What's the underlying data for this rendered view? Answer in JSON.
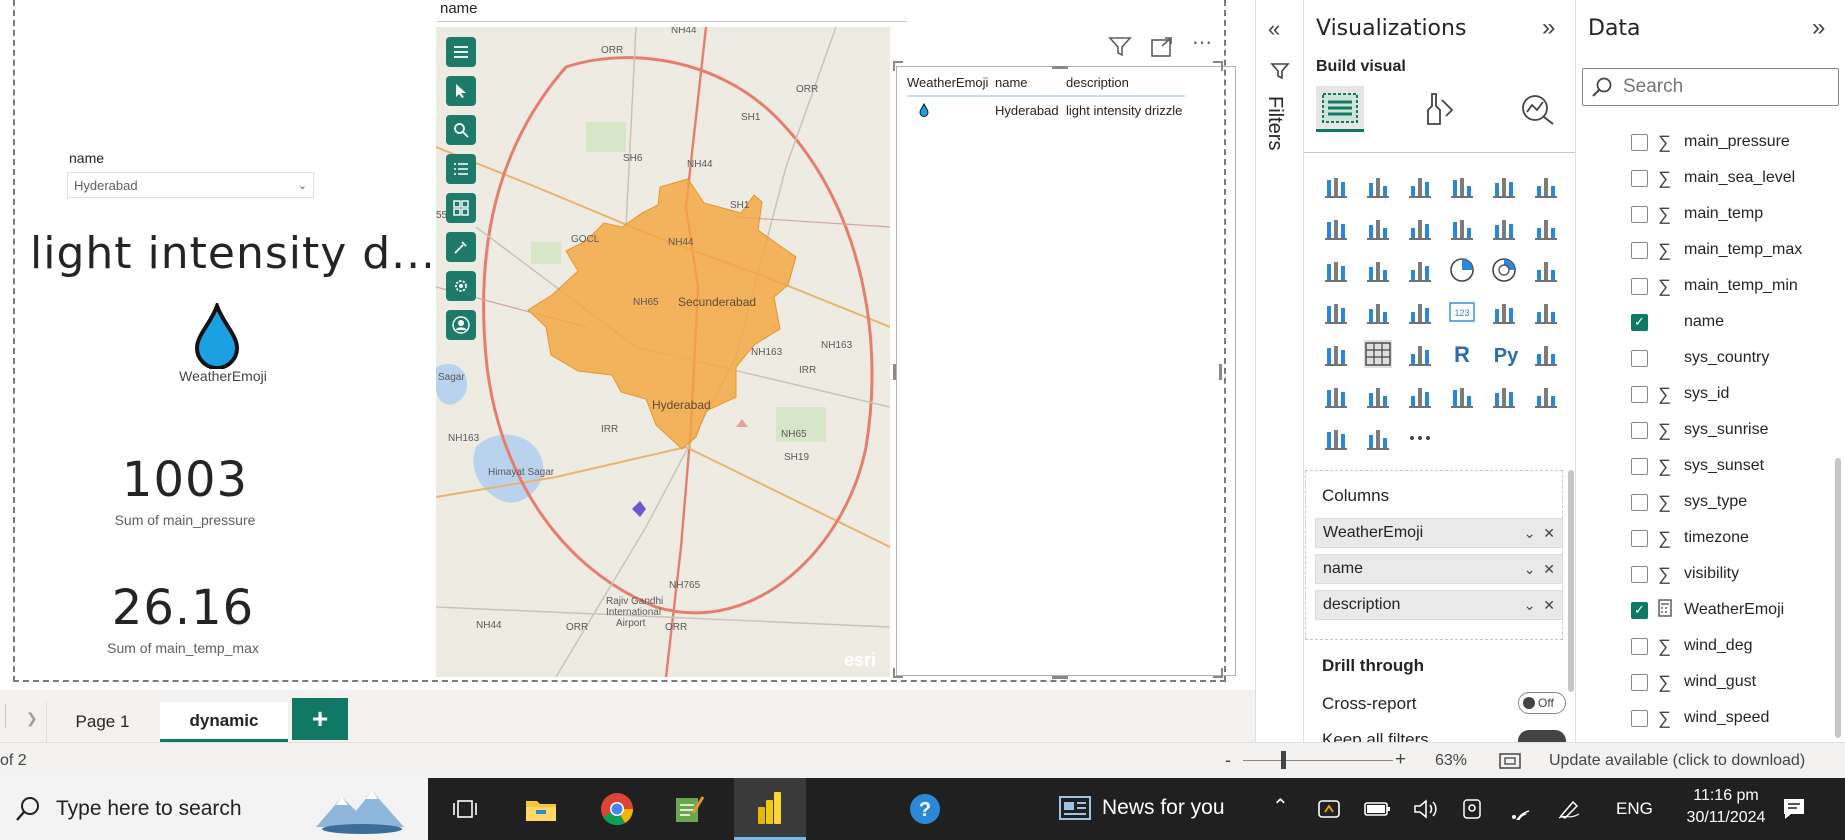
{
  "report": {
    "slicer": {
      "label": "name",
      "selected": "Hyderabad"
    },
    "description_card": "light intensity d...",
    "emoji_card": {
      "label": "WeatherEmoji"
    },
    "kpi_pressure": {
      "value": "1003",
      "label": "Sum of main_pressure"
    },
    "kpi_temp_max": {
      "value": "26.16",
      "label": "Sum of main_temp_max"
    },
    "map_title": "name",
    "map_labels": {
      "secunderabad": "Secunderabad",
      "hyderabad": "Hyderabad",
      "orr1": "ORR",
      "orr2": "ORR",
      "orr3": "ORR",
      "orr4": "ORR",
      "nh44a": "NH44",
      "nh44b": "NH44",
      "nh44c": "NH44",
      "nh44d": "NH44",
      "nh65a": "NH65",
      "nh65b": "NH65",
      "sh6": "SH6",
      "sh1a": "SH1",
      "sh1b": "SH1",
      "gocl": "GOCL",
      "nh163a": "NH163",
      "nh163b": "NH163",
      "nh163c": "NH163",
      "irr1": "IRR",
      "irr2": "IRR",
      "sh19": "SH19",
      "nh765": "NH765",
      "sagar": "Sagar",
      "himayat": "Himayat Sagar",
      "airport1": "Rajiv Gandhi",
      "airport2": "International",
      "airport3": "Airport",
      "esri": "esri",
      "num55": "55"
    },
    "table": {
      "headers": [
        "WeatherEmoji",
        "name",
        "description"
      ],
      "row": {
        "name": "Hyderabad",
        "description": "light intensity drizzle"
      }
    }
  },
  "filters_pane": {
    "label": "Filters"
  },
  "visualizations": {
    "title": "Visualizations",
    "subtitle": "Build visual",
    "columns_label": "Columns",
    "wells": [
      "WeatherEmoji",
      "name",
      "description"
    ],
    "drill_through": "Drill through",
    "cross_report": "Cross-report",
    "toggle_off": "Off",
    "keep_all_filters": "Keep all filters"
  },
  "data_pane": {
    "title": "Data",
    "search_placeholder": "Search",
    "fields": [
      {
        "name": "main_pressure",
        "sigma": true,
        "checked": false
      },
      {
        "name": "main_sea_level",
        "sigma": true,
        "checked": false
      },
      {
        "name": "main_temp",
        "sigma": true,
        "checked": false
      },
      {
        "name": "main_temp_max",
        "sigma": true,
        "checked": false
      },
      {
        "name": "main_temp_min",
        "sigma": true,
        "checked": false
      },
      {
        "name": "name",
        "sigma": false,
        "checked": true
      },
      {
        "name": "sys_country",
        "sigma": false,
        "checked": false
      },
      {
        "name": "sys_id",
        "sigma": true,
        "checked": false
      },
      {
        "name": "sys_sunrise",
        "sigma": true,
        "checked": false
      },
      {
        "name": "sys_sunset",
        "sigma": true,
        "checked": false
      },
      {
        "name": "sys_type",
        "sigma": true,
        "checked": false
      },
      {
        "name": "timezone",
        "sigma": true,
        "checked": false
      },
      {
        "name": "visibility",
        "sigma": true,
        "checked": false
      },
      {
        "name": "WeatherEmoji",
        "sigma": false,
        "calc": true,
        "checked": true
      },
      {
        "name": "wind_deg",
        "sigma": true,
        "checked": false
      },
      {
        "name": "wind_gust",
        "sigma": true,
        "checked": false
      },
      {
        "name": "wind_speed",
        "sigma": true,
        "checked": false
      }
    ]
  },
  "tabs": {
    "page1": "Page 1",
    "dynamic": "dynamic",
    "add": "+"
  },
  "status": {
    "page_of": "of 2",
    "zoom": "63%",
    "update": "Update available (click to download)",
    "minus": "-",
    "plus": "+"
  },
  "taskbar": {
    "search": "Type here to search",
    "news": "News for you",
    "lang": "ENG",
    "time": "11:16 pm",
    "date": "30/11/2024"
  },
  "colors": {
    "accent": "#117865",
    "map_region": "#f4a640",
    "emoji_blue": "#1ba1e2"
  }
}
